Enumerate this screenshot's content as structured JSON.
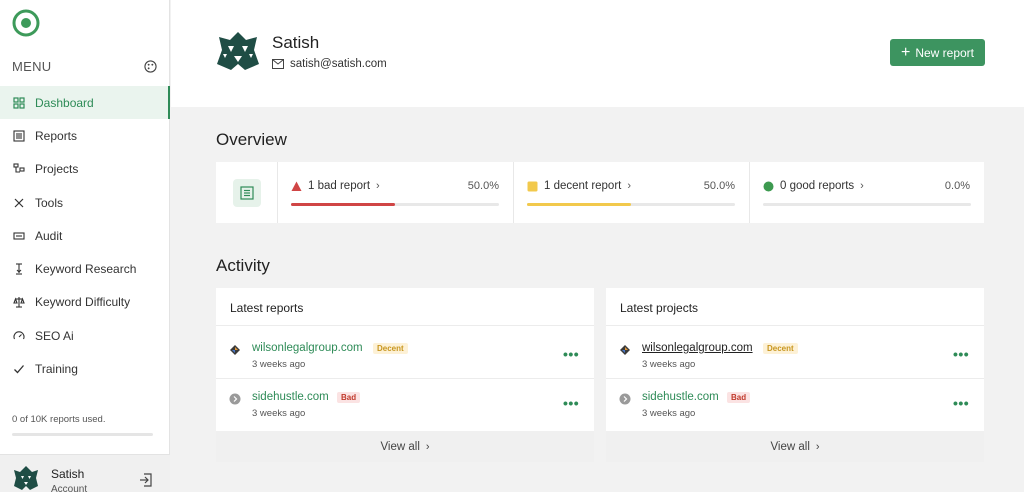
{
  "sidebar": {
    "menu_label": "MENU",
    "items": [
      {
        "label": "Dashboard",
        "icon": "grid-icon",
        "active": true
      },
      {
        "label": "Reports",
        "icon": "list-icon"
      },
      {
        "label": "Projects",
        "icon": "projects-icon"
      },
      {
        "label": "Tools",
        "icon": "tools-icon"
      },
      {
        "label": "Audit",
        "icon": "audit-icon"
      },
      {
        "label": "Keyword Research",
        "icon": "keyword-research-icon"
      },
      {
        "label": "Keyword Difficulty",
        "icon": "scale-icon"
      },
      {
        "label": "SEO Ai",
        "icon": "speedometer-icon"
      },
      {
        "label": "Training",
        "icon": "check-icon"
      }
    ],
    "usage_text": "0 of 10K reports used.",
    "usage_fraction": 0,
    "user": {
      "name": "Satish",
      "sub": "Account"
    }
  },
  "header": {
    "name": "Satish",
    "email": "satish@satish.com",
    "new_report": "New report"
  },
  "overview": {
    "title": "Overview",
    "stats": [
      {
        "label": "1 bad report",
        "percent": "50.0%",
        "value": 50,
        "color": "#d04545",
        "marker": "triangle"
      },
      {
        "label": "1 decent report",
        "percent": "50.0%",
        "value": 50,
        "color": "#f2c94c",
        "marker": "square"
      },
      {
        "label": "0 good reports",
        "percent": "0.0%",
        "value": 0,
        "color": "#3d9a50",
        "marker": "circle"
      }
    ]
  },
  "activity": {
    "title": "Activity",
    "latest_reports": {
      "title": "Latest reports",
      "rows": [
        {
          "domain": "wilsonlegalgroup.com",
          "badge": "Decent",
          "time": "3 weeks ago"
        },
        {
          "domain": "sidehustle.com",
          "badge": "Bad",
          "time": "3 weeks ago"
        }
      ],
      "view_all": "View all"
    },
    "latest_projects": {
      "title": "Latest projects",
      "rows": [
        {
          "domain": "wilsonlegalgroup.com",
          "badge": "Decent",
          "time": "3 weeks ago"
        },
        {
          "domain": "sidehustle.com",
          "badge": "Bad",
          "time": "3 weeks ago"
        }
      ],
      "view_all": "View all"
    }
  },
  "colors": {
    "accent": "#2e8b57",
    "button": "#3d9460"
  }
}
